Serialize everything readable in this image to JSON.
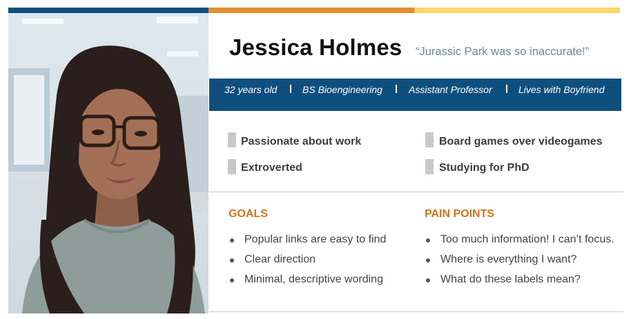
{
  "colors": {
    "bar_blue": "#0f4f7e",
    "bar_orange": "#e48e2d",
    "bar_yellow": "#fad66b",
    "section_title": "#d2731c",
    "quote": "#6c8796"
  },
  "persona": {
    "photo_icon": "portrait-photo",
    "name": "Jessica Holmes",
    "quote": "“Jurassic Park was so inaccurate!”"
  },
  "infobar": {
    "items": [
      "32 years old",
      "BS Bioengineering",
      "Assistant Professor",
      "Lives with Boyfriend"
    ]
  },
  "traits": {
    "left": [
      "Passionate about work",
      "Extroverted"
    ],
    "right": [
      "Board games over videogames",
      "Studying for PhD"
    ]
  },
  "goals": {
    "title": "GOALS",
    "items": [
      "Popular links are easy to find",
      "Clear direction",
      "Minimal, descriptive wording"
    ]
  },
  "pain_points": {
    "title": "PAIN POINTS",
    "items": [
      "Too much information! I can’t focus.",
      "Where is everything I want?",
      "What do these labels mean?"
    ]
  }
}
